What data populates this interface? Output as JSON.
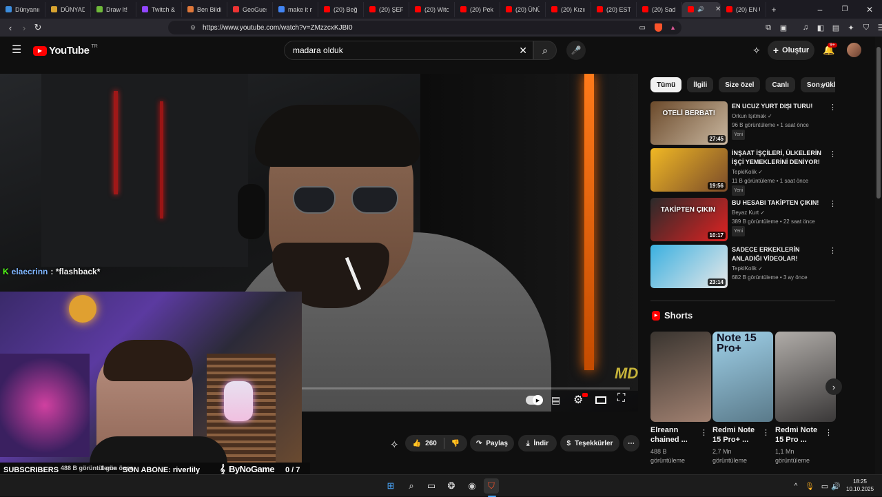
{
  "browser": {
    "tabs": [
      {
        "label": "Dünyanın",
        "color": "#3c8dde"
      },
      {
        "label": "DÜNYADA",
        "color": "#d8a330"
      },
      {
        "label": "Draw It!",
        "color": "#6fba3a"
      },
      {
        "label": "Twitch &",
        "color": "#9146ff"
      },
      {
        "label": "Ben Bildiğ",
        "color": "#e0783a"
      },
      {
        "label": "GeoGuess",
        "color": "#e33"
      },
      {
        "label": "make it m",
        "color": "#4285f4"
      },
      {
        "label": "(20) Beğe",
        "color": "#f00"
      },
      {
        "label": "(20) ŞEF,",
        "color": "#f00"
      },
      {
        "label": "(20) Witc",
        "color": "#f00"
      },
      {
        "label": "(20) Pek",
        "color": "#f00"
      },
      {
        "label": "(20) ÜNÜ",
        "color": "#f00"
      },
      {
        "label": "(20) Kızın",
        "color": "#f00"
      },
      {
        "label": "(20) ESTE",
        "color": "#f00"
      },
      {
        "label": "(20) Sadı",
        "color": "#f00"
      }
    ],
    "active_tab": {
      "label": "(2",
      "color": "#f00"
    },
    "last_tab": {
      "label": "(20) EN U",
      "color": "#f00"
    },
    "url": "https://www.youtube.com/watch?v=ZMzzcxKJBI0"
  },
  "youtube": {
    "logo_text": "YouTube",
    "logo_region": "TR",
    "search_value": "madara olduk",
    "create_label": "Oluştur",
    "notif_count": "9+"
  },
  "overlay": {
    "chat_user": "elaecrinn",
    "chat_msg": ": *flashback*",
    "watermark": "MD",
    "ticker_left": "SUBSCRIBERS",
    "ticker_views": "488 B görüntüleme",
    "ticker_time": "1 gün önce",
    "ticker_abone": "SON ABONE: riverlily",
    "ticker_brand": "ByNoGame",
    "ticker_count": "0 / 7"
  },
  "actions": {
    "like_count": "260",
    "share": "Paylaş",
    "download": "İndir",
    "thanks": "Teşekkürler"
  },
  "chips": [
    "Tümü",
    "İlgili",
    "Size özel",
    "Canlı",
    "Son yükle"
  ],
  "recommended": [
    {
      "title": "EN UCUZ YURT DIŞI TURU!",
      "channel": "Orkun Işıtmak",
      "meta": "96 B görüntüleme • 1 saat önce",
      "badge": "Yeni",
      "duration": "27:45",
      "thumb_text": "OTELİ BERBAT!",
      "c1": "#6b4a2b",
      "c2": "#c9b7a0"
    },
    {
      "title": "İNŞAAT İŞÇİLERİ, ÜLKELERİN İŞÇİ YEMEKLERİNİ DENİYOR!",
      "channel": "TepkiKolik",
      "meta": "11 B görüntüleme • 1 saat önce",
      "badge": "Yeni",
      "duration": "19:56",
      "thumb_text": "",
      "c1": "#f0b824",
      "c2": "#7a4b2a"
    },
    {
      "title": "BU HESABI TAKİPTEN ÇIKIN!",
      "channel": "Beyaz Kurt",
      "meta": "389 B görüntüleme • 22 saat önce",
      "badge": "Yeni",
      "duration": "10:17",
      "thumb_text": "TAKİPTEN ÇIKIN",
      "c1": "#2a2a2a",
      "c2": "#e02222"
    },
    {
      "title": "SADECE ERKEKLERİN ANLADIĞI VİDEOLAR!",
      "channel": "TepkiKolik",
      "meta": "682 B görüntüleme • 3 ay önce",
      "badge": "",
      "duration": "23:14",
      "thumb_text": "",
      "c1": "#3ab0e0",
      "c2": "#e8e8e8"
    }
  ],
  "shorts_heading": "Shorts",
  "shorts": [
    {
      "title": "Elreann chained ...",
      "views": "488 B görüntüleme",
      "c1": "#3a3530",
      "c2": "#a08070",
      "overlay": ""
    },
    {
      "title": "Redmi Note 15 Pro+ ...",
      "views": "2,7 Mn görüntüleme",
      "c1": "#9fd0e8",
      "c2": "#5a7a8a",
      "overlay": "Note 15 Pro+"
    },
    {
      "title": "Redmi Note 15 Pro ...",
      "views": "1,1 Mn görüntüleme",
      "c1": "#b0aca8",
      "c2": "#3a3838",
      "overlay": ""
    }
  ],
  "taskbar": {
    "time": "18:25",
    "date": "10.10.2025"
  }
}
